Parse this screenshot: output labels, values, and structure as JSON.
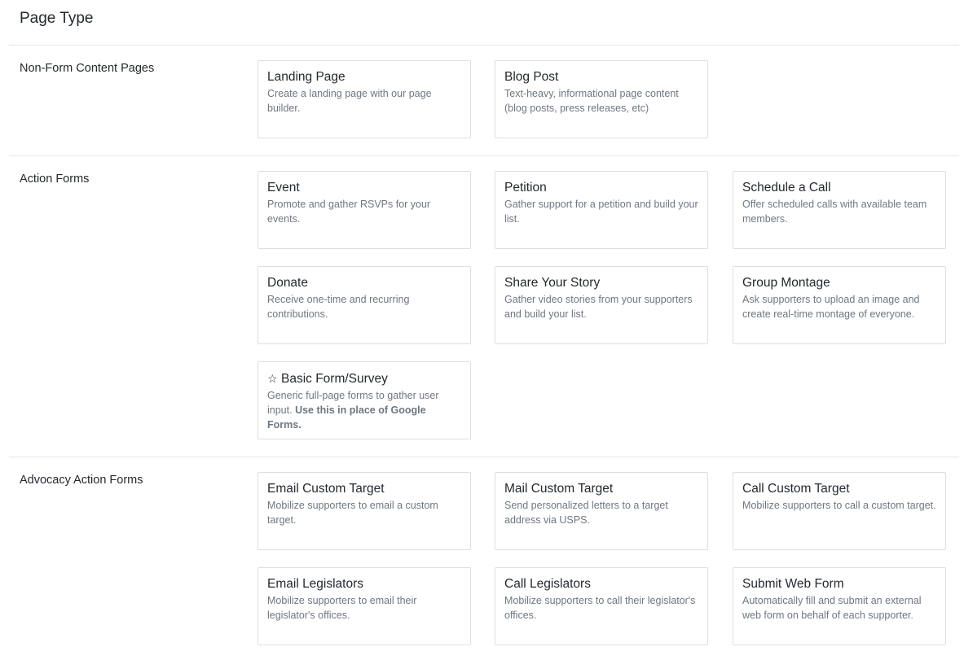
{
  "page_title": "Page Type",
  "sections": {
    "non_form": {
      "label": "Non-Form Content Pages",
      "cards": [
        {
          "title": "Landing Page",
          "desc": "Create a landing page with our page builder."
        },
        {
          "title": "Blog Post",
          "desc": "Text-heavy, informational page content (blog posts, press releases, etc)"
        }
      ]
    },
    "action": {
      "label": "Action Forms",
      "cards": [
        {
          "title": "Event",
          "desc": "Promote and gather RSVPs for your events."
        },
        {
          "title": "Petition",
          "desc": "Gather support for a petition and build your list."
        },
        {
          "title": "Schedule a Call",
          "desc": "Offer scheduled calls with available team members."
        },
        {
          "title": "Donate",
          "desc": "Receive one-time and recurring contributions."
        },
        {
          "title": "Share Your Story",
          "desc": "Gather video stories from your supporters and build your list."
        },
        {
          "title": "Group Montage",
          "desc": "Ask supporters to upload an image and create real-time montage of everyone."
        },
        {
          "title": "Basic Form/Survey",
          "icon": "star-outline-icon",
          "icon_glyph": "☆",
          "desc": "Generic full-page forms to gather user input.",
          "desc_bold": "Use this in place of Google Forms."
        }
      ]
    },
    "advocacy": {
      "label": "Advocacy Action Forms",
      "cards": [
        {
          "title": "Email Custom Target",
          "desc": "Mobilize supporters to email a custom target."
        },
        {
          "title": "Mail Custom Target",
          "desc": "Send personalized letters to a target address via USPS."
        },
        {
          "title": "Call Custom Target",
          "desc": "Mobilize supporters to call a custom target."
        },
        {
          "title": "Email Legislators",
          "desc": "Mobilize supporters to email their legislator's offices."
        },
        {
          "title": "Call Legislators",
          "desc": "Mobilize supporters to call their legislator's offices."
        },
        {
          "title": "Submit Web Form",
          "desc": "Automatically fill and submit an external web form on behalf of each supporter."
        }
      ]
    }
  }
}
